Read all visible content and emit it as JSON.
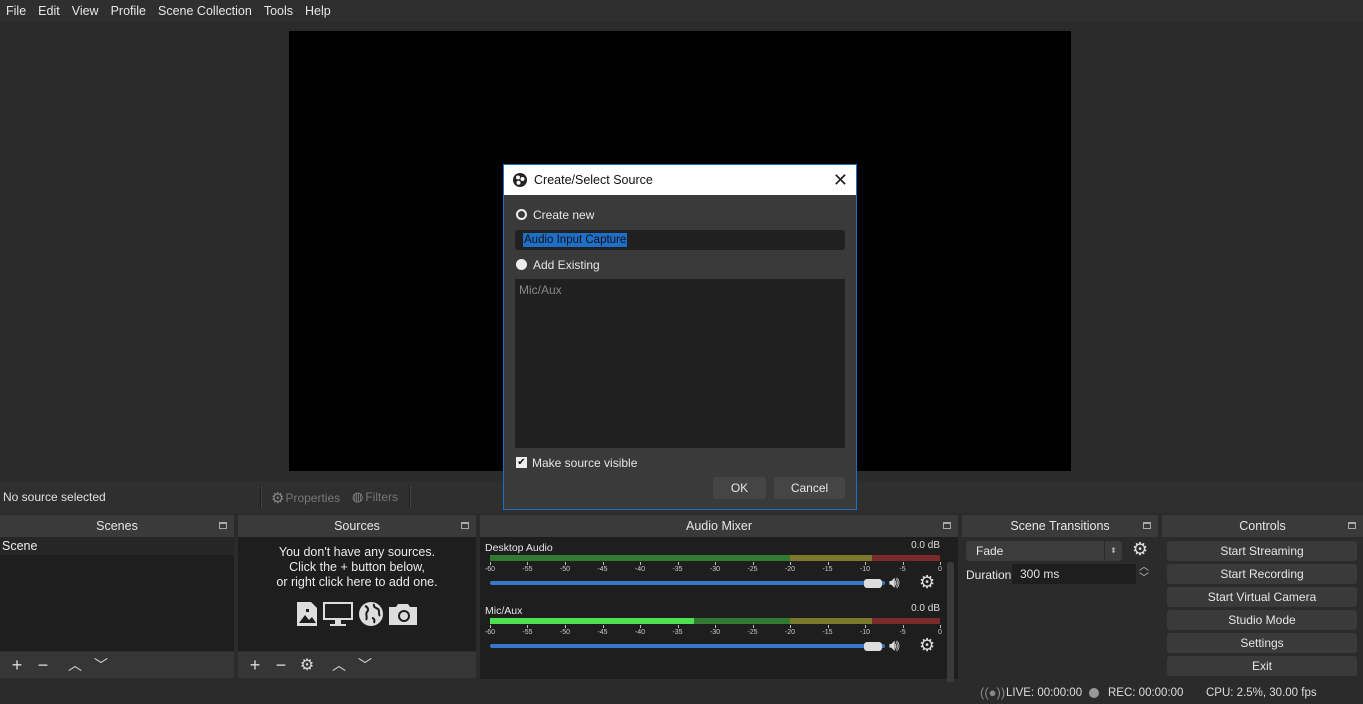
{
  "menu": [
    "File",
    "Edit",
    "View",
    "Profile",
    "Scene Collection",
    "Tools",
    "Help"
  ],
  "source_toolbar": {
    "status": "No source selected",
    "properties_label": "Properties",
    "filters_label": "Filters"
  },
  "scenes": {
    "title": "Scenes",
    "items": [
      "Scene"
    ]
  },
  "sources": {
    "title": "Sources",
    "empty_lines": [
      "You don't have any sources.",
      "Click the + button below,",
      "or right click here to add one."
    ]
  },
  "mixer": {
    "title": "Audio Mixer",
    "ticks": [
      "-60",
      "-55",
      "-50",
      "-45",
      "-40",
      "-35",
      "-30",
      "-25",
      "-20",
      "-15",
      "-10",
      "-5",
      "0"
    ],
    "channels": [
      {
        "name": "Desktop Audio",
        "db": "0.0 dB",
        "volume_fraction": 1.0
      },
      {
        "name": "Mic/Aux",
        "db": "0.0 dB",
        "volume_fraction": 1.0
      }
    ]
  },
  "transitions": {
    "title": "Scene Transitions",
    "selected": "Fade",
    "duration_label": "Duration",
    "duration_value": "300 ms"
  },
  "controls": {
    "title": "Controls",
    "buttons": [
      "Start Streaming",
      "Start Recording",
      "Start Virtual Camera",
      "Studio Mode",
      "Settings",
      "Exit"
    ]
  },
  "status": {
    "live": "LIVE: 00:00:00",
    "rec": "REC: 00:00:00",
    "cpu": "CPU: 2.5%, 30.00 fps"
  },
  "dialog": {
    "title": "Create/Select Source",
    "create_new_label": "Create new",
    "name_value": "Audio Input Capture",
    "add_existing_label": "Add Existing",
    "existing_items": [
      "Mic/Aux"
    ],
    "make_visible_label": "Make source visible",
    "make_visible_checked": true,
    "ok_label": "OK",
    "cancel_label": "Cancel"
  }
}
